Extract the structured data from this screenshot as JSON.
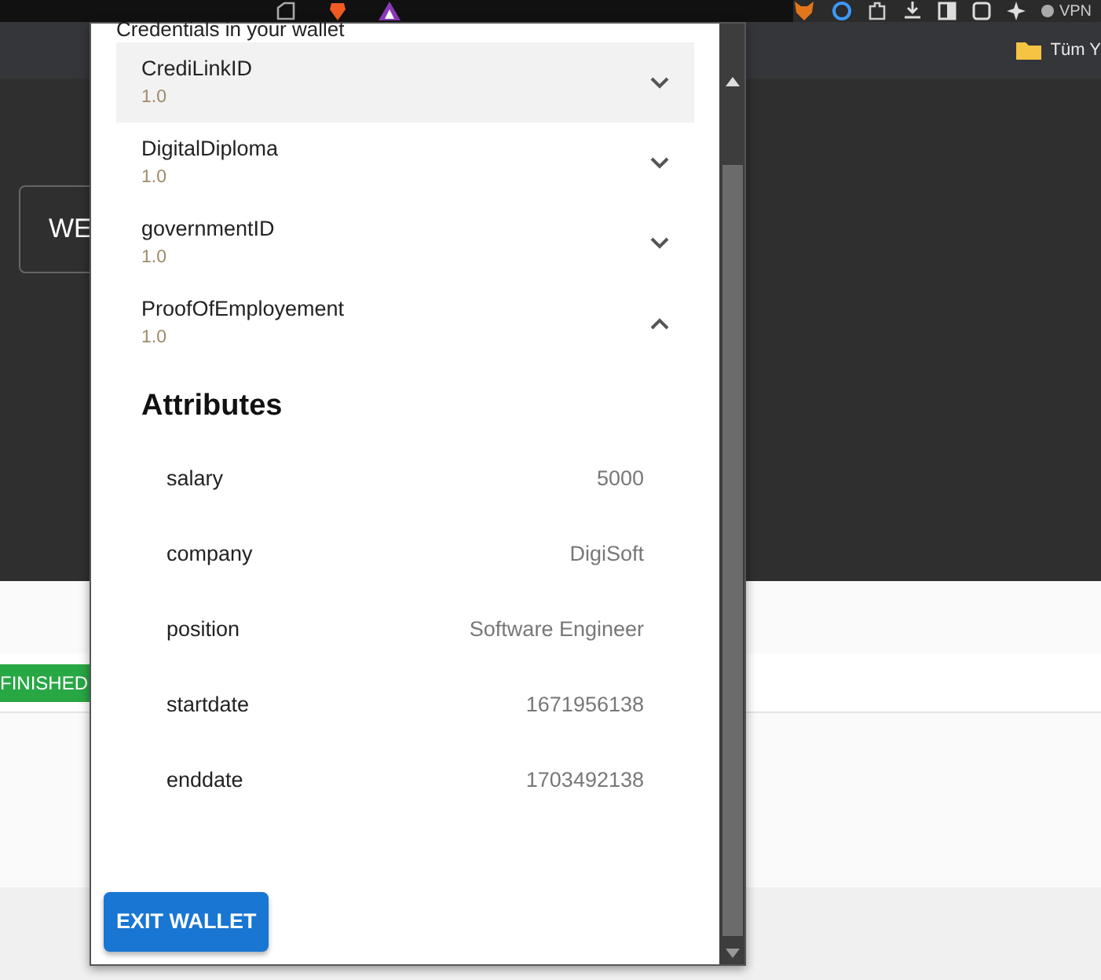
{
  "browser": {
    "vpn_label": "VPN",
    "bookmark": "Tüm Y"
  },
  "page": {
    "button_label": "WE",
    "status_badge": "FINISHED"
  },
  "wallet": {
    "heading": "Credentials in your wallet",
    "credentials": [
      {
        "name": "CrediLinkID",
        "version": "1.0",
        "selected": true,
        "expanded": false
      },
      {
        "name": "DigitalDiploma",
        "version": "1.0",
        "selected": false,
        "expanded": false
      },
      {
        "name": "governmentID",
        "version": "1.0",
        "selected": false,
        "expanded": false
      },
      {
        "name": "ProofOfEmployement",
        "version": "1.0",
        "selected": false,
        "expanded": true,
        "attributes_title": "Attributes",
        "attributes": [
          {
            "key": "salary",
            "value": "5000"
          },
          {
            "key": "company",
            "value": "DigiSoft"
          },
          {
            "key": "position",
            "value": "Software Engineer"
          },
          {
            "key": "startdate",
            "value": "1671956138"
          },
          {
            "key": "enddate",
            "value": "1703492138"
          }
        ]
      }
    ],
    "exit_button": "EXIT WALLET"
  }
}
